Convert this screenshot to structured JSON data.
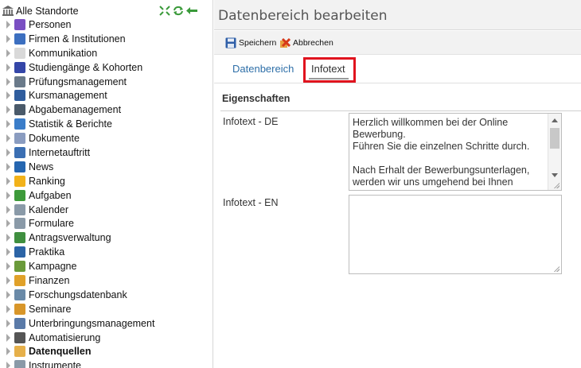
{
  "sidebar": {
    "root_label": "Alle Standorte",
    "items": [
      {
        "label": "Personen",
        "icon": "users-icon",
        "color": "#7a4fc3"
      },
      {
        "label": "Firmen & Institutionen",
        "icon": "buildings-icon",
        "color": "#3c6fc0"
      },
      {
        "label": "Kommunikation",
        "icon": "envelope-icon",
        "color": "#d9d9d9"
      },
      {
        "label": "Studiengänge & Kohorten",
        "icon": "quill-icon",
        "color": "#3446a8"
      },
      {
        "label": "Prüfungsmanagement",
        "icon": "exam-icon",
        "color": "#6a7a8a"
      },
      {
        "label": "Kursmanagement",
        "icon": "book-icon",
        "color": "#2f5d9e"
      },
      {
        "label": "Abgabemanagement",
        "icon": "id-card-icon",
        "color": "#4a5a6a"
      },
      {
        "label": "Statistik & Berichte",
        "icon": "bar-chart-icon",
        "color": "#3a7dc9"
      },
      {
        "label": "Dokumente",
        "icon": "folder-icon",
        "color": "#8a9cc0"
      },
      {
        "label": "Internetauftritt",
        "icon": "globe-icon",
        "color": "#3b6fb3"
      },
      {
        "label": "News",
        "icon": "info-icon",
        "color": "#2566b0"
      },
      {
        "label": "Ranking",
        "icon": "star-icon",
        "color": "#f2b21a"
      },
      {
        "label": "Aufgaben",
        "icon": "clock-icon",
        "color": "#3d9a3a"
      },
      {
        "label": "Kalender",
        "icon": "calendar-icon",
        "color": "#8a9aa8"
      },
      {
        "label": "Formulare",
        "icon": "form-icon",
        "color": "#8a9aa8"
      },
      {
        "label": "Antragsverwaltung",
        "icon": "application-icon",
        "color": "#3f8f3f"
      },
      {
        "label": "Praktika",
        "icon": "checklist-icon",
        "color": "#2c64a6"
      },
      {
        "label": "Kampagne",
        "icon": "campaign-icon",
        "color": "#6a9a3a"
      },
      {
        "label": "Finanzen",
        "icon": "coins-icon",
        "color": "#e0a12a"
      },
      {
        "label": "Forschungsdatenbank",
        "icon": "chart-line-icon",
        "color": "#6a8aa8"
      },
      {
        "label": "Seminare",
        "icon": "briefcase-icon",
        "color": "#d8962a"
      },
      {
        "label": "Unterbringungsmanagement",
        "icon": "building-icon",
        "color": "#5a7aa8"
      },
      {
        "label": "Automatisierung",
        "icon": "gear-icon",
        "color": "#555555"
      },
      {
        "label": "Datenquellen",
        "icon": "data-folder-icon",
        "color": "#e6b04a",
        "bold": true
      },
      {
        "label": "Instrumente",
        "icon": "tools-icon",
        "color": "#8a9aa8"
      }
    ]
  },
  "main": {
    "title": "Datenbereich bearbeiten",
    "toolbar": {
      "save_label": "Speichern",
      "cancel_label": "Abbrechen"
    },
    "tabs": [
      {
        "label": "Datenbereich"
      },
      {
        "label": "Infotext"
      }
    ],
    "section_title": "Eigenschaften",
    "fields": [
      {
        "label": "Infotext - DE",
        "value": "Herzlich willkommen bei der Online Bewerbung.\nFühren Sie die einzelnen Schritte durch.\n\nNach Erhalt der Bewerbungsunterlagen, werden wir uns umgehend bei Ihnen"
      },
      {
        "label": "Infotext - EN",
        "value": ""
      }
    ]
  }
}
